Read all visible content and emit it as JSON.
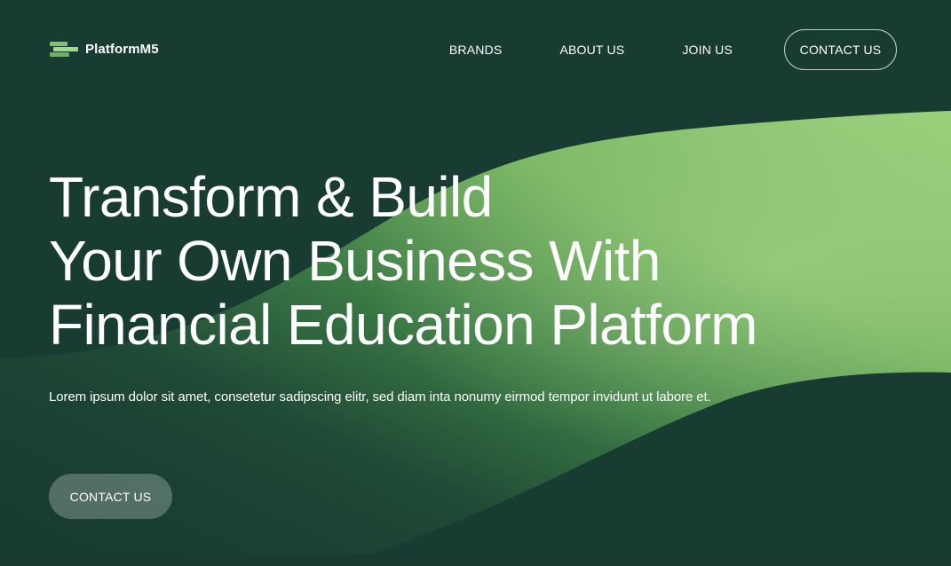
{
  "brand": {
    "name": "PlatformM5",
    "logo_icon": "stacked-bars-logo-icon",
    "logo_colors": [
      "#7dc46a",
      "#a2d88a",
      "#6bb35c"
    ]
  },
  "nav": {
    "links": [
      "BRANDS",
      "ABOUT US",
      "JOIN US"
    ],
    "contact_label": "CONTACT US"
  },
  "hero": {
    "title_lines": [
      "Transform & Build",
      "Your Own Business With",
      "Financial Education Platform"
    ],
    "subtitle": "Lorem ipsum dolor sit amet, consetetur sadipscing elitr, sed diam inta nonumy eirmod tempor invidunt ut labore et.",
    "cta_label": "CONTACT US"
  },
  "colors": {
    "background": "#183c32",
    "wave_light": "#98cf75",
    "wave_dark": "#2f6a3c"
  }
}
